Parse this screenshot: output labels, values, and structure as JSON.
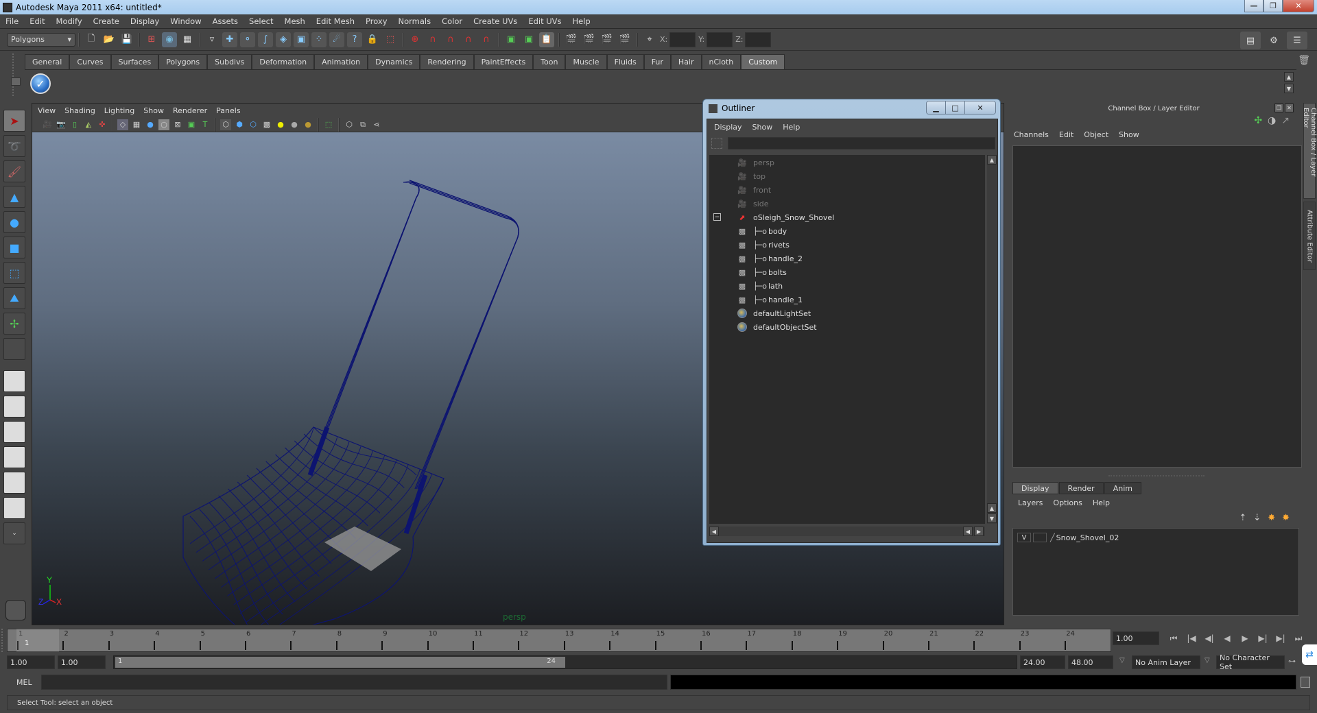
{
  "window": {
    "title": "Autodesk Maya 2011 x64: untitled*",
    "minimize": "—",
    "maximize": "❐",
    "close": "✕"
  },
  "menubar": [
    "File",
    "Edit",
    "Modify",
    "Create",
    "Display",
    "Window",
    "Assets",
    "Select",
    "Mesh",
    "Edit Mesh",
    "Proxy",
    "Normals",
    "Color",
    "Create UVs",
    "Edit UVs",
    "Help"
  ],
  "statusline": {
    "mode": "Polygons",
    "x_label": "X:",
    "y_label": "Y:",
    "z_label": "Z:",
    "x_value": "",
    "y_value": "",
    "z_value": ""
  },
  "shelf": {
    "tabs": [
      "General",
      "Curves",
      "Surfaces",
      "Polygons",
      "Subdivs",
      "Deformation",
      "Animation",
      "Dynamics",
      "Rendering",
      "PaintEffects",
      "Toon",
      "Muscle",
      "Fluids",
      "Fur",
      "Hair",
      "nCloth",
      "Custom"
    ],
    "active_tab": "Custom",
    "button_glyph": "✓"
  },
  "viewport": {
    "menu": [
      "View",
      "Shading",
      "Lighting",
      "Show",
      "Renderer",
      "Panels"
    ],
    "camera_label": "persp",
    "axis": {
      "x": "X",
      "y": "Y",
      "z": "Z"
    },
    "wire_color": "#0d1470"
  },
  "outliner": {
    "title": "Outliner",
    "menu": [
      "Display",
      "Show",
      "Help"
    ],
    "filter_value": "",
    "items": [
      {
        "label": "persp",
        "type": "camera",
        "dim": true,
        "depth": 0
      },
      {
        "label": "top",
        "type": "camera",
        "dim": true,
        "depth": 0
      },
      {
        "label": "front",
        "type": "camera",
        "dim": true,
        "depth": 0
      },
      {
        "label": "side",
        "type": "camera",
        "dim": true,
        "depth": 0
      },
      {
        "label": "Sleigh_Snow_Shovel",
        "type": "group",
        "dim": false,
        "depth": 0,
        "expanded": true
      },
      {
        "label": "body",
        "type": "mesh",
        "dim": false,
        "depth": 1
      },
      {
        "label": "rivets",
        "type": "mesh",
        "dim": false,
        "depth": 1
      },
      {
        "label": "handle_2",
        "type": "mesh",
        "dim": false,
        "depth": 1
      },
      {
        "label": "bolts",
        "type": "mesh",
        "dim": false,
        "depth": 1
      },
      {
        "label": "lath",
        "type": "mesh",
        "dim": false,
        "depth": 1
      },
      {
        "label": "handle_1",
        "type": "mesh",
        "dim": false,
        "depth": 1
      },
      {
        "label": "defaultLightSet",
        "type": "set",
        "dim": false,
        "depth": 0
      },
      {
        "label": "defaultObjectSet",
        "type": "set",
        "dim": false,
        "depth": 0
      }
    ]
  },
  "channel_box": {
    "title": "Channel Box / Layer Editor",
    "menu": [
      "Channels",
      "Edit",
      "Object",
      "Show"
    ]
  },
  "layer_editor": {
    "tabs": [
      "Display",
      "Render",
      "Anim"
    ],
    "active_tab": "Display",
    "menu": [
      "Layers",
      "Options",
      "Help"
    ],
    "layers": [
      {
        "visible": "V",
        "name": "Snow_Shovel_02"
      }
    ]
  },
  "side_tabs": [
    "Channel Box / Layer Editor",
    "Attribute Editor"
  ],
  "timeline": {
    "ticks": [
      "1",
      "2",
      "3",
      "4",
      "5",
      "6",
      "7",
      "8",
      "9",
      "10",
      "11",
      "12",
      "13",
      "14",
      "15",
      "16",
      "17",
      "18",
      "19",
      "20",
      "21",
      "22",
      "23",
      "24"
    ],
    "current_frame": "1",
    "current_frame_field": "1.00"
  },
  "range": {
    "anim_start": "1.00",
    "playback_start": "1.00",
    "slider_start_label": "1",
    "slider_end_label": "24",
    "playback_end": "24.00",
    "anim_end": "48.00",
    "anim_layer": "No Anim Layer",
    "character_set": "No Character Set"
  },
  "playback": [
    "⏮",
    "|◀",
    "◀|",
    "◀",
    "▶",
    "▶|",
    "▶|",
    "⏭"
  ],
  "command_line": {
    "label": "MEL",
    "value": ""
  },
  "help_line": "Select Tool: select an object"
}
